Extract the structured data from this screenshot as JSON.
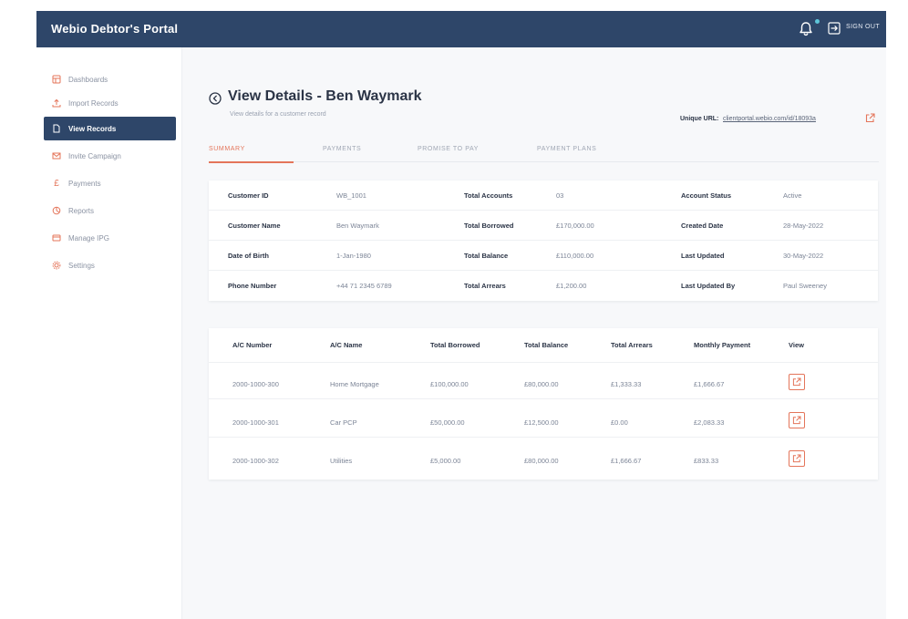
{
  "header": {
    "brand": "Webio Debtor's Portal",
    "signout_label": "SIGN OUT"
  },
  "sidebar": {
    "items": [
      {
        "label": "Dashboards",
        "icon": "dashboard-icon"
      },
      {
        "label": "Import Records",
        "icon": "upload-icon"
      },
      {
        "label": "View Records",
        "icon": "records-icon"
      },
      {
        "label": "Invite Campaign",
        "icon": "envelope-icon"
      },
      {
        "label": "Payments",
        "icon": "pound-icon"
      },
      {
        "label": "Reports",
        "icon": "chart-icon"
      },
      {
        "label": "Manage IPG",
        "icon": "card-icon"
      },
      {
        "label": "Settings",
        "icon": "gear-icon"
      }
    ],
    "active_index": 2
  },
  "page": {
    "title": "View Details - Ben Waymark",
    "subtitle": "View details for a customer record",
    "unique_url_label": "Unique URL:",
    "unique_url_value": "clientportal.webio.com/id/18093a"
  },
  "tabs": [
    {
      "label": "SUMMARY",
      "active": true
    },
    {
      "label": "PAYMENTS",
      "active": false
    },
    {
      "label": "PROMISE TO PAY",
      "active": false
    },
    {
      "label": "PAYMENT PLANS",
      "active": false
    }
  ],
  "summary": {
    "rows": [
      {
        "l1": "Customer ID",
        "v1": "WB_1001",
        "l2": "Total Accounts",
        "v2": "03",
        "l3": "Account Status",
        "v3": "Active"
      },
      {
        "l1": "Customer Name",
        "v1": "Ben Waymark",
        "l2": "Total Borrowed",
        "v2": "£170,000.00",
        "l3": "Created Date",
        "v3": "28-May-2022"
      },
      {
        "l1": "Date of Birth",
        "v1": "1-Jan-1980",
        "l2": "Total Balance",
        "v2": "£110,000.00",
        "l3": "Last Updated",
        "v3": "30-May-2022"
      },
      {
        "l1": "Phone Number",
        "v1": "+44 71 2345 6789",
        "l2": "Total Arrears",
        "v2": "£1,200.00",
        "l3": "Last Updated By",
        "v3": "Paul Sweeney"
      }
    ]
  },
  "accounts": {
    "columns": [
      "A/C Number",
      "A/C Name",
      "Total Borrowed",
      "Total Balance",
      "Total Arrears",
      "Monthly Payment",
      "View"
    ],
    "rows": [
      [
        "2000-1000-300",
        "Home Mortgage",
        "£100,000.00",
        "£80,000.00",
        "£1,333.33",
        "£1,666.67"
      ],
      [
        "2000-1000-301",
        "Car PCP",
        "£50,000.00",
        "£12,500.00",
        "£0.00",
        "£2,083.33"
      ],
      [
        "2000-1000-302",
        "Utilities",
        "£5,000.00",
        "£80,000.00",
        "£1,666.67",
        "£833.33"
      ]
    ]
  },
  "colors": {
    "navy": "#2e4669",
    "accent": "#e4755a",
    "notification_dot": "#5ec5d9"
  }
}
